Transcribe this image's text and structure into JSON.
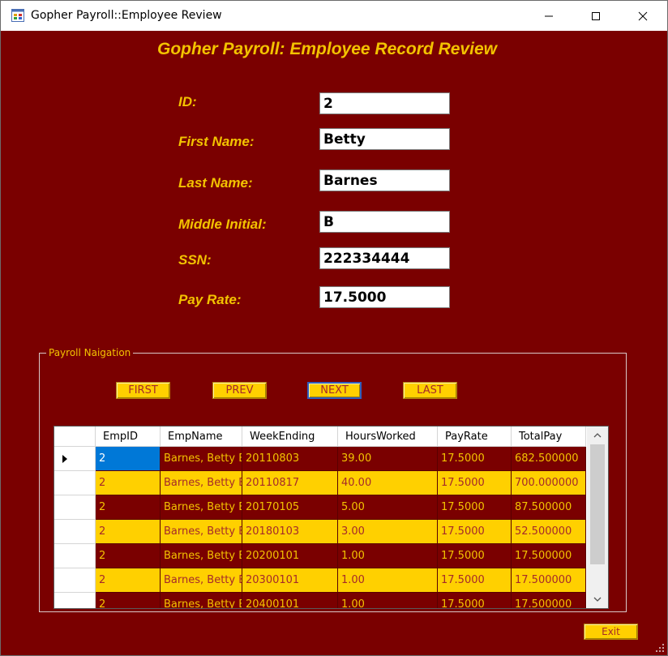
{
  "window": {
    "title": "Gopher Payroll::Employee Review",
    "controls": {
      "minimize_icon": "minimize-icon",
      "maximize_icon": "maximize-icon",
      "close_icon": "close-icon"
    }
  },
  "form": {
    "heading": "Gopher Payroll: Employee Record Review",
    "fields": {
      "id": {
        "label": "ID:",
        "value": "2"
      },
      "first_name": {
        "label": "First Name:",
        "value": "Betty"
      },
      "last_name": {
        "label": "Last Name:",
        "value": "Barnes"
      },
      "middle_initial": {
        "label": "Middle Initial:",
        "value": "B"
      },
      "ssn": {
        "label": "SSN:",
        "value": "222334444"
      },
      "pay_rate": {
        "label": "Pay Rate:",
        "value": "17.5000"
      }
    }
  },
  "navigation": {
    "group_title": "Payroll Naigation",
    "buttons": {
      "first": "FIRST",
      "prev": "PREV",
      "next": "NEXT",
      "last": "LAST"
    }
  },
  "grid": {
    "columns": [
      "EmpID",
      "EmpName",
      "WeekEnding",
      "HoursWorked",
      "PayRate",
      "TotalPay"
    ],
    "rows": [
      [
        "2",
        "Barnes, Betty B",
        "20110803",
        "39.00",
        "17.5000",
        "682.500000"
      ],
      [
        "2",
        "Barnes, Betty B",
        "20110817",
        "40.00",
        "17.5000",
        "700.000000"
      ],
      [
        "2",
        "Barnes, Betty B",
        "20170105",
        "5.00",
        "17.5000",
        "87.500000"
      ],
      [
        "2",
        "Barnes, Betty B",
        "20180103",
        "3.00",
        "17.5000",
        "52.500000"
      ],
      [
        "2",
        "Barnes, Betty B",
        "20200101",
        "1.00",
        "17.5000",
        "17.500000"
      ],
      [
        "2",
        "Barnes, Betty B",
        "20300101",
        "1.00",
        "17.5000",
        "17.500000"
      ],
      [
        "2",
        "Barnes, Betty B",
        "20400101",
        "1.00",
        "17.5000",
        "17.500000"
      ]
    ]
  },
  "footer": {
    "exit_label": "Exit"
  },
  "colors": {
    "background": "#7a0000",
    "accent_yellow": "#f3c300",
    "button_gold": "#ffd000",
    "selection_blue": "#0078d7"
  }
}
